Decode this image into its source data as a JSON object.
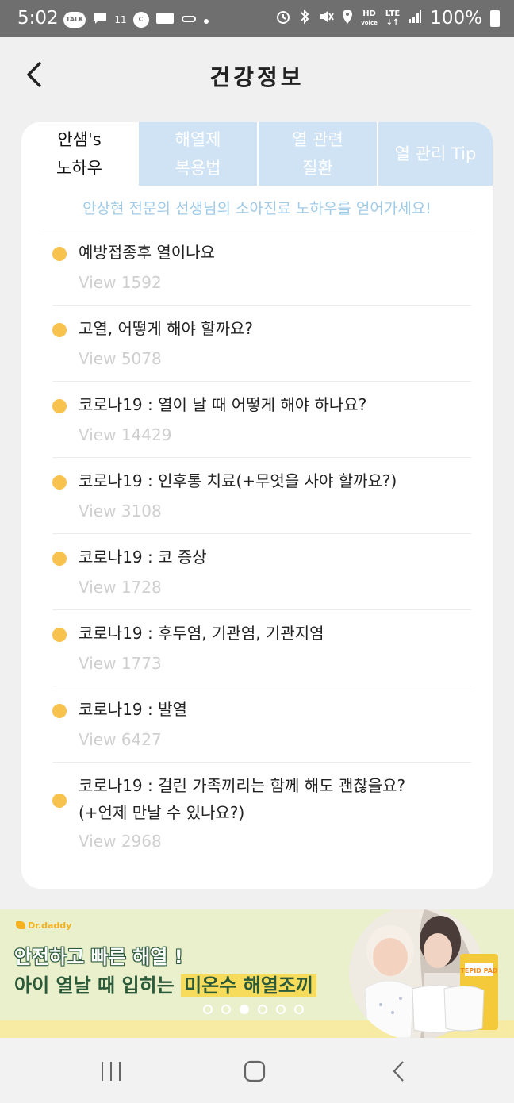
{
  "status_bar": {
    "time": "5:02",
    "notif_talk": "TALK",
    "notif_count": "11",
    "notif_c": "C",
    "hd_label": "HD",
    "voice_label": "voice",
    "lte_label": "LTE",
    "battery": "100%"
  },
  "header": {
    "title": "건강정보"
  },
  "tabs": [
    {
      "label": "안샘's\n노하우"
    },
    {
      "label": "해열제\n복용법"
    },
    {
      "label": "열 관련\n질환"
    },
    {
      "label": "열 관리 Tip"
    }
  ],
  "subtitle": "안상현 전문의 선생님의 소아진료 노하우를 얻어가세요!",
  "articles": [
    {
      "title": "예방접종후 열이나요",
      "views": "View 1592"
    },
    {
      "title": "고열, 어떻게 해야 할까요?",
      "views": "View 5078"
    },
    {
      "title": "코로나19 : 열이 날 때 어떻게 해야 하나요?",
      "views": "View 14429"
    },
    {
      "title": "코로나19 : 인후통 치료(+무엇을 사야 할까요?)",
      "views": "View 3108"
    },
    {
      "title": "코로나19 : 코 증상",
      "views": "View 1728"
    },
    {
      "title": "코로나19 : 후두염, 기관염, 기관지염",
      "views": "View 1773"
    },
    {
      "title": "코로나19 : 발열",
      "views": "View 6427"
    },
    {
      "title": "코로나19 : 걸린 가족끼리는 함께 해도 괜찮을요?",
      "title_line2": "(+언제 만날 수 있나요?)",
      "views": "View 2968"
    }
  ],
  "banner": {
    "brand": "Dr.daddy",
    "line1": "안전하고 빠른 해열 !",
    "line2_prefix": "아이 열날 때 입히는 ",
    "line2_highlight": "미온수 해열조끼",
    "product_label": "TEPID PAD",
    "pages": 6,
    "current_page": 3
  },
  "colors": {
    "accent_dot": "#f7c24d",
    "tab_inactive": "#cfe3f5",
    "subtitle": "#9fcbe8"
  }
}
